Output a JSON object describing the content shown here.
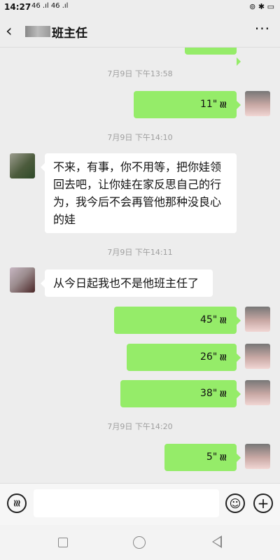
{
  "status": {
    "time": "14:27",
    "signal": "46 .ıl 46 .ıl",
    "right_icons": "⊚ ✱ ▭"
  },
  "header": {
    "back_icon": "back-chevron-icon",
    "title": "班主任",
    "more_icon": "more-icon"
  },
  "messages": [
    {
      "type": "timestamp",
      "text": "7月9日 下午13:58"
    },
    {
      "type": "voice",
      "side": "right",
      "duration": "11\""
    },
    {
      "type": "timestamp",
      "text": "7月9日 下午14:10"
    },
    {
      "type": "text",
      "side": "left",
      "lines": [
        "不来，有事，你不用等，把你娃领",
        "回去吧，让你娃在家反思自己的行",
        "为，我今后不会再管他那种没良心",
        "的娃"
      ]
    },
    {
      "type": "timestamp",
      "text": "7月9日 下午14:11"
    },
    {
      "type": "text",
      "side": "left",
      "lines": [
        "从今日起我也不是他班主任了"
      ]
    },
    {
      "type": "voice",
      "side": "right",
      "duration": "45\""
    },
    {
      "type": "voice",
      "side": "right",
      "duration": "26\""
    },
    {
      "type": "voice",
      "side": "right",
      "duration": "38\""
    },
    {
      "type": "timestamp",
      "text": "7月9日 下午14:20"
    },
    {
      "type": "voice",
      "side": "right",
      "duration": "5\""
    }
  ],
  "voice_wave_glyph": "⦿",
  "input": {
    "voice_icon": "voice-input-icon",
    "emoji_icon": "emoji-icon",
    "plus_icon": "plus-icon",
    "placeholder": ""
  }
}
